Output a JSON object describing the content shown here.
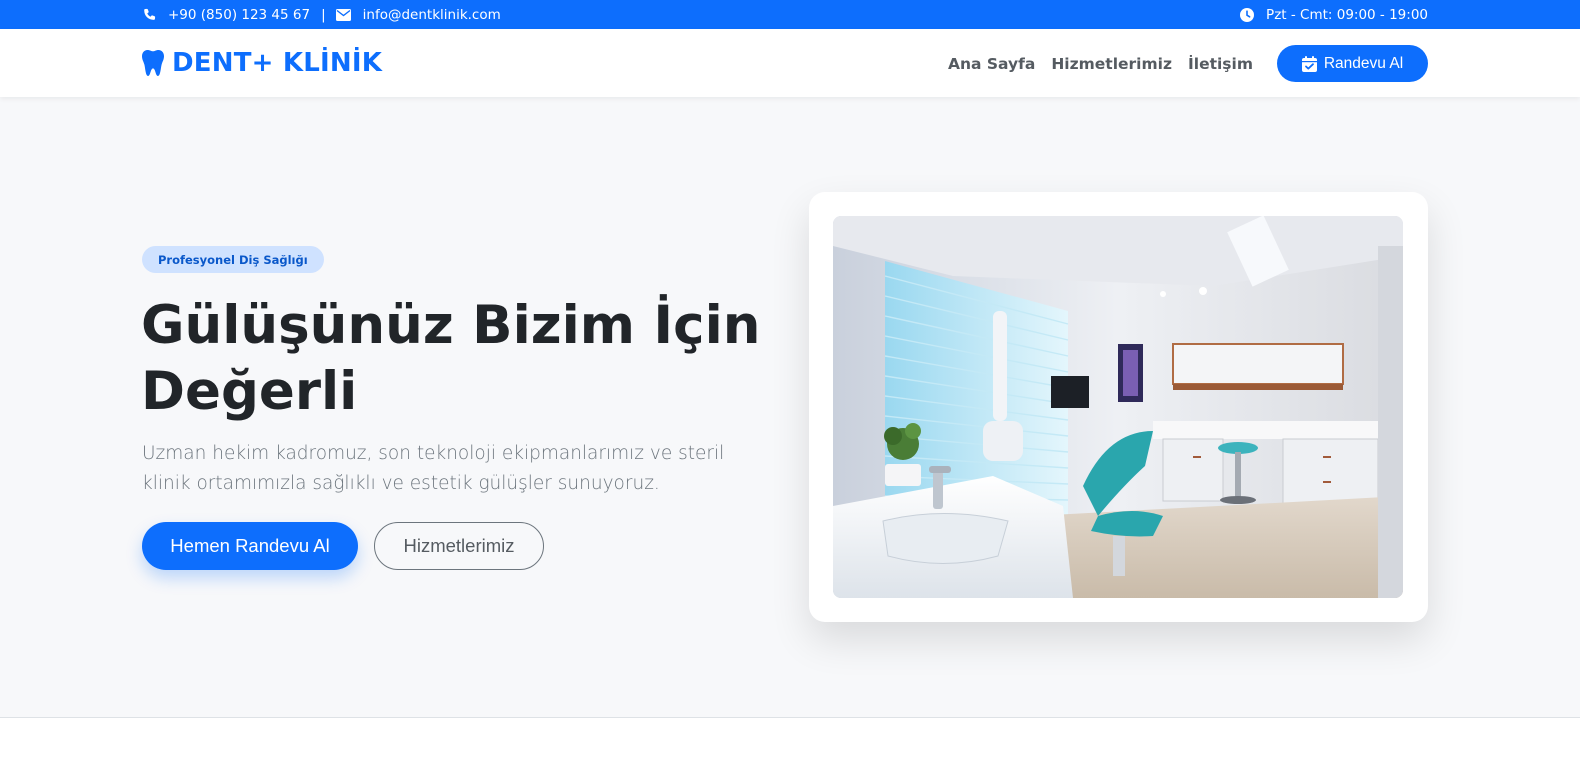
{
  "topbar": {
    "phone": "+90 (850) 123 45 67",
    "separator": "|",
    "email": "info@dentklinik.com",
    "hours": "Pzt - Cmt: 09:00 - 19:00",
    "icons": {
      "phone": "phone-icon",
      "email": "envelope-icon",
      "hours": "clock-icon"
    }
  },
  "navbar": {
    "brand": "DENT+ KLİNİK",
    "brand_icon": "tooth-icon",
    "links": [
      "Ana Sayfa",
      "Hizmetlerimiz",
      "İletişim"
    ],
    "cta_label": "Randevu Al",
    "cta_icon": "calendar-check-icon"
  },
  "hero": {
    "badge": "Profesyonel Diş Sağlığı",
    "title": "Gülüşünüz Bizim İçin Değerli",
    "subtitle": "Uzman hekim kadromuz, son teknoloji ekipmanlarımız ve steril klinik ortamımızla sağlıklı ve estetik gülüşler sunuyoruz.",
    "primary_button": "Hemen Randevu Al",
    "secondary_button": "Hizmetlerimiz",
    "image_subject": "dental-clinic-room-photo"
  },
  "colors": {
    "primary": "#0d6efd",
    "badge_bg": "#cfe2ff",
    "hero_bg": "#f7f8fa",
    "text_dark": "#212529",
    "text_muted": "#6c757d"
  }
}
